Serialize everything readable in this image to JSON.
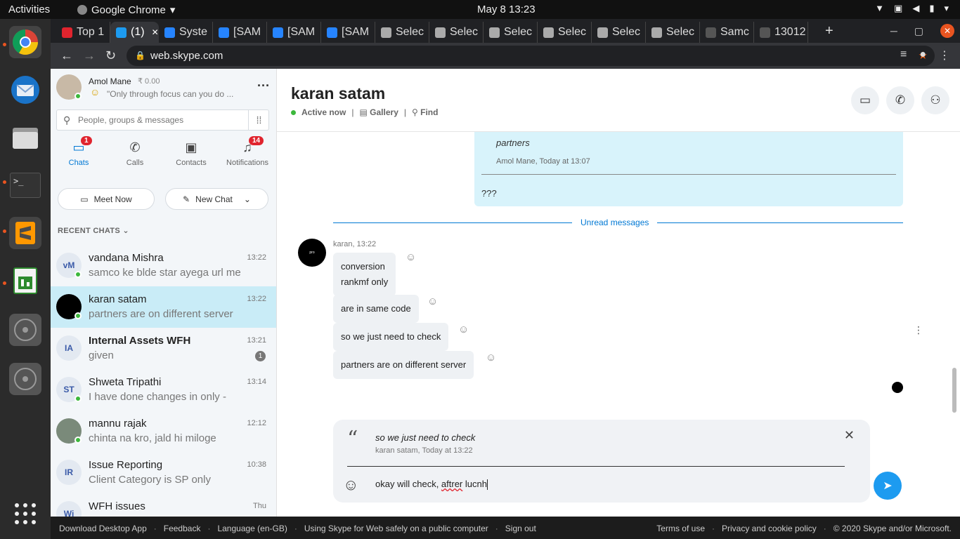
{
  "os": {
    "activities": "Activities",
    "app_name": "Google Chrome",
    "clock": "May 8  13:23"
  },
  "browser": {
    "tabs": [
      {
        "label": "Top 1",
        "color": "#e0242e"
      },
      {
        "label": "(1)",
        "color": "#1d9bf0"
      },
      {
        "label": "Syste",
        "color": "#2684ff"
      },
      {
        "label": "[SAM",
        "color": "#2684ff"
      },
      {
        "label": "[SAM",
        "color": "#2684ff"
      },
      {
        "label": "[SAM",
        "color": "#2684ff"
      },
      {
        "label": "Selec",
        "color": "#aaaaaa"
      },
      {
        "label": "Selec",
        "color": "#aaaaaa"
      },
      {
        "label": "Selec",
        "color": "#aaaaaa"
      },
      {
        "label": "Selec",
        "color": "#aaaaaa"
      },
      {
        "label": "Selec",
        "color": "#aaaaaa"
      },
      {
        "label": "Selec",
        "color": "#aaaaaa"
      },
      {
        "label": "Samc",
        "color": "#555555"
      },
      {
        "label": "13012",
        "color": "#555555"
      }
    ],
    "url": "web.skype.com"
  },
  "profile": {
    "name": "Amol Mane",
    "credit": "₹ 0.00",
    "mood": "\"Only through focus can you do ..."
  },
  "search": {
    "placeholder": "People, groups & messages"
  },
  "nav": {
    "chats": "Chats",
    "chats_badge": "1",
    "calls": "Calls",
    "contacts": "Contacts",
    "notifications": "Notifications",
    "notifications_badge": "14"
  },
  "buttons": {
    "meet_now": "Meet Now",
    "new_chat": "New Chat"
  },
  "recent_label": "RECENT CHATS",
  "chats": [
    {
      "initials": "vM",
      "name": "vandana Mishra",
      "preview": "samco ke blde star ayega url me",
      "time": "13:22"
    },
    {
      "initials": "",
      "name": "karan satam",
      "preview": "partners are on different server",
      "time": "13:22"
    },
    {
      "initials": "IA",
      "name": "Internal Assets WFH",
      "preview": "given",
      "time": "13:21",
      "unread": "1"
    },
    {
      "initials": "ST",
      "name": "Shweta Tripathi",
      "preview": "I have done changes in only -",
      "time": "13:14"
    },
    {
      "initials": "",
      "name": "mannu rajak",
      "preview": "chinta na kro, jald hi miloge",
      "time": "12:12"
    },
    {
      "initials": "IR",
      "name": "Issue Reporting",
      "preview": "Client Category is SP only",
      "time": "10:38"
    },
    {
      "initials": "Wi",
      "name": "WFH issues",
      "preview": "",
      "time": "Thu"
    }
  ],
  "conversation": {
    "title": "karan satam",
    "status": "Active now",
    "gallery": "Gallery",
    "find": "Find",
    "my_quote_text": "partners",
    "my_quote_meta": "Amol Mane, Today at 13:07",
    "my_message": "???",
    "unread_label": "Unread messages",
    "sender_line": "karan, 13:22",
    "messages": [
      "conversion\nrankmf only",
      "are in same code",
      "so we just need to check",
      "partners are on different server"
    ]
  },
  "composer": {
    "quote_text": "so we just need to check",
    "quote_meta": "karan satam, Today at 13:22",
    "draft_before": "okay will check, ",
    "draft_misspelled": "aftrer",
    "draft_after": " lucnh"
  },
  "footer": {
    "download": "Download Desktop App",
    "feedback": "Feedback",
    "language": "Language (en-GB)",
    "safety": "Using Skype for Web safely on a public computer",
    "signout": "Sign out",
    "terms": "Terms of use",
    "privacy": "Privacy and cookie policy",
    "copyright": "© 2020 Skype and/or Microsoft."
  }
}
